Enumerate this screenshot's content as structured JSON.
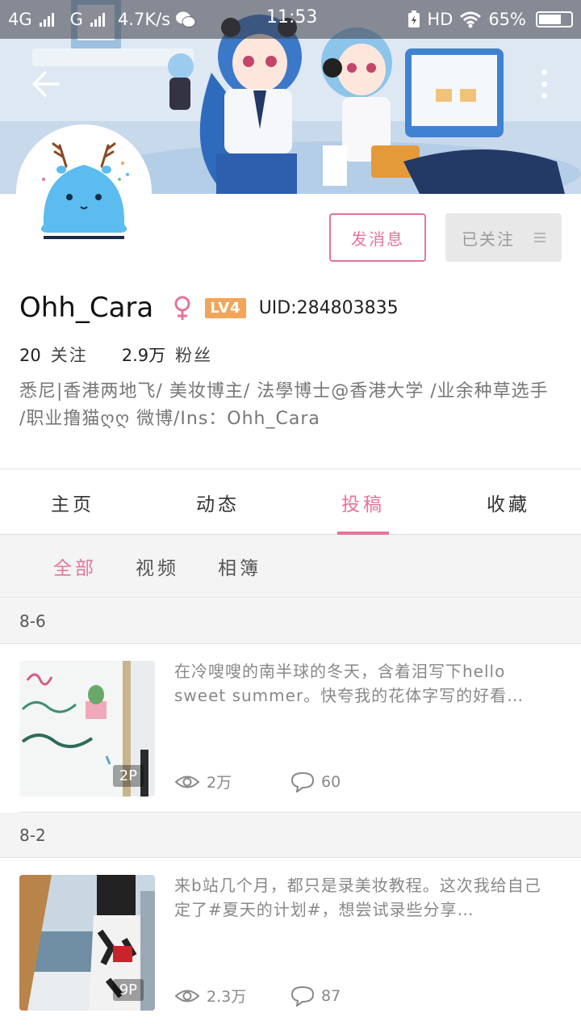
{
  "status_bar": {
    "network1": "4G",
    "network2": "G",
    "speed": "4.7K/s",
    "time": "11:53",
    "hd": "HD",
    "battery": "65%"
  },
  "header": {
    "back_icon": "arrow-left-icon",
    "more_icon": "more-vertical-icon"
  },
  "actions": {
    "message_label": "发消息",
    "follow_label": "已关注"
  },
  "profile": {
    "username": "Ohh_Cara",
    "gender_icon": "female-icon",
    "level": "LV4",
    "uid": "UID:284803835",
    "following_count": "20",
    "following_label": "关注",
    "followers_count": "2.9万",
    "followers_label": "粉丝",
    "bio": "悉尼|香港两地飞/ 美妆博主/ 法學博士@香港大学 /业余种草选手 /职业撸猫ღღ 微博/Ins：Ohh_Cara"
  },
  "tabs": [
    {
      "label": "主页",
      "active": false
    },
    {
      "label": "动态",
      "active": false
    },
    {
      "label": "投稿",
      "active": true
    },
    {
      "label": "收藏",
      "active": false
    }
  ],
  "subtabs": [
    {
      "label": "全部",
      "active": true
    },
    {
      "label": "视频",
      "active": false
    },
    {
      "label": "相簿",
      "active": false
    }
  ],
  "posts": [
    {
      "date": "8-6",
      "description": "在冷嗖嗖的南半球的冬天，含着泪写下hello sweet summer。快夸我的花体字写的好看…",
      "page_count": "2P",
      "views": "2万",
      "comments": "60"
    },
    {
      "date": "8-2",
      "description": "来b站几个月，都只是录美妆教程。这次我给自己定了#夏天的计划#，想尝试录些分享…",
      "page_count": "9P",
      "views": "2.3万",
      "comments": "87"
    }
  ],
  "colors": {
    "accent": "#e5739b",
    "level_badge": "#f2a55a",
    "follow_button_bg": "#e8e8e8"
  }
}
